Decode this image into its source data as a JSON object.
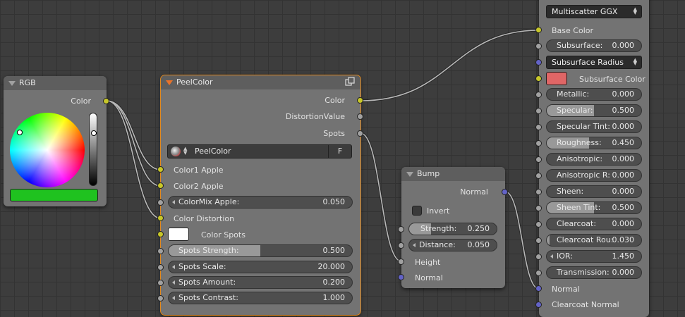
{
  "colors": {
    "node_body": "#737373",
    "node_header": "#5e5e5e",
    "socket_color": "#c7c729",
    "socket_float": "#a1a1a1",
    "socket_vector": "#6363c7",
    "selected_outline": "#e58a1c",
    "rgb_value": "#1fc21f",
    "subsurface_color": "#e06666",
    "color_spots": "#ffffff"
  },
  "rgb_node": {
    "title": "RGB",
    "output_color_label": "Color",
    "swatch_color": "#1fc21f"
  },
  "peel_node": {
    "title": "PeelColor",
    "outputs": {
      "color": "Color",
      "distortion_value": "DistortionValue",
      "spots": "Spots"
    },
    "group_name": "PeelColor",
    "fake_user": "F",
    "inputs": {
      "color1": "Color1 Apple",
      "color2": "Color2 Apple",
      "colormix_label": "ColorMix Apple:",
      "colormix_value": "0.050",
      "color_distortion": "Color Distortion",
      "color_spots": "Color Spots",
      "spots_strength_label": "Spots Strength:",
      "spots_strength_value": "0.500",
      "spots_strength_fraction": 0.5,
      "spots_scale_label": "Spots Scale:",
      "spots_scale_value": "20.000",
      "spots_amount_label": "Spots Amount:",
      "spots_amount_value": "0.200",
      "spots_contrast_label": "Spots Contrast:",
      "spots_contrast_value": "1.000"
    }
  },
  "bump_node": {
    "title": "Bump",
    "output_normal": "Normal",
    "invert_label": "Invert",
    "invert_checked": false,
    "strength_label": "Strength:",
    "strength_value": "0.250",
    "strength_fraction": 0.25,
    "distance_label": "Distance:",
    "distance_value": "0.050",
    "height_label": "Height",
    "normal_label": "Normal"
  },
  "principled_node": {
    "distribution": "Multiscatter GGX",
    "base_color": "Base Color",
    "subsurface_method": "Subsurface Radius",
    "subsurface_color_label": "Subsurface Color",
    "params": [
      {
        "label": "Subsurface:",
        "value": "0.000",
        "fraction": 0
      },
      {
        "label": "Metallic:",
        "value": "0.000",
        "fraction": 0
      },
      {
        "label": "Specular:",
        "value": "0.500",
        "fraction": 0.5
      },
      {
        "label": "Specular Tint:",
        "value": "0.000",
        "fraction": 0
      },
      {
        "label": "Roughness:",
        "value": "0.450",
        "fraction": 0.45
      },
      {
        "label": "Anisotropic:",
        "value": "0.000",
        "fraction": 0
      },
      {
        "label": "Anisotropic R:",
        "value": "0.000",
        "fraction": 0
      },
      {
        "label": "Sheen:",
        "value": "0.000",
        "fraction": 0
      },
      {
        "label": "Sheen Tint:",
        "value": "0.500",
        "fraction": 0.5
      },
      {
        "label": "Clearcoat:",
        "value": "0.000",
        "fraction": 0
      },
      {
        "label": "Clearcoat Rou:",
        "value": "0.030",
        "fraction": 0.03
      },
      {
        "label": "IOR:",
        "value": "1.450",
        "fraction": 0
      },
      {
        "label": "Transmission:",
        "value": "0.000",
        "fraction": 0
      }
    ],
    "normal_label": "Normal",
    "clearcoat_normal_label": "Clearcoat Normal"
  }
}
